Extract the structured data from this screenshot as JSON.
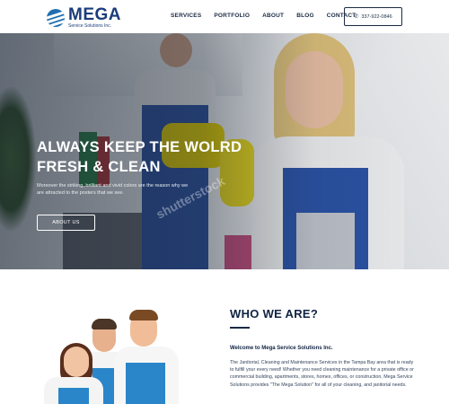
{
  "header": {
    "logo": {
      "name": "MEGA",
      "tagline": "Service Solutions Inc."
    },
    "nav": [
      "SERVICES",
      "PORTFOLIO",
      "ABOUT",
      "BLOG",
      "CONTACT"
    ],
    "phone": "337-922-0846",
    "phone_icon": "phone-icon"
  },
  "hero": {
    "title": "ALWAYS KEEP THE WOLRD FRESH & CLEAN",
    "text": "Moreover the striking, brilliant and vivid colors are the reason why we are attracted to the posters that we see.",
    "button": "ABOUT US",
    "watermark": "shutterstock"
  },
  "who": {
    "title": "WHO WE ARE?",
    "subtitle": "Welcome to Mega Service Solutions Inc.",
    "text": "The Janitorial, Cleaning and Maintenance Services in the Tampa Bay area that is ready to fulfill your every need! Whether you need cleaning maintenance for a private office or commercial building, apartments, stores, homes, offices, or construction, Mega Service Solutions provides \"The Mega Solution\" for all of your cleaning, and janitorial needs."
  },
  "colors": {
    "navy": "#0f2342",
    "brand_blue": "#1a3c7a",
    "accent_blue": "#2a86c9"
  }
}
